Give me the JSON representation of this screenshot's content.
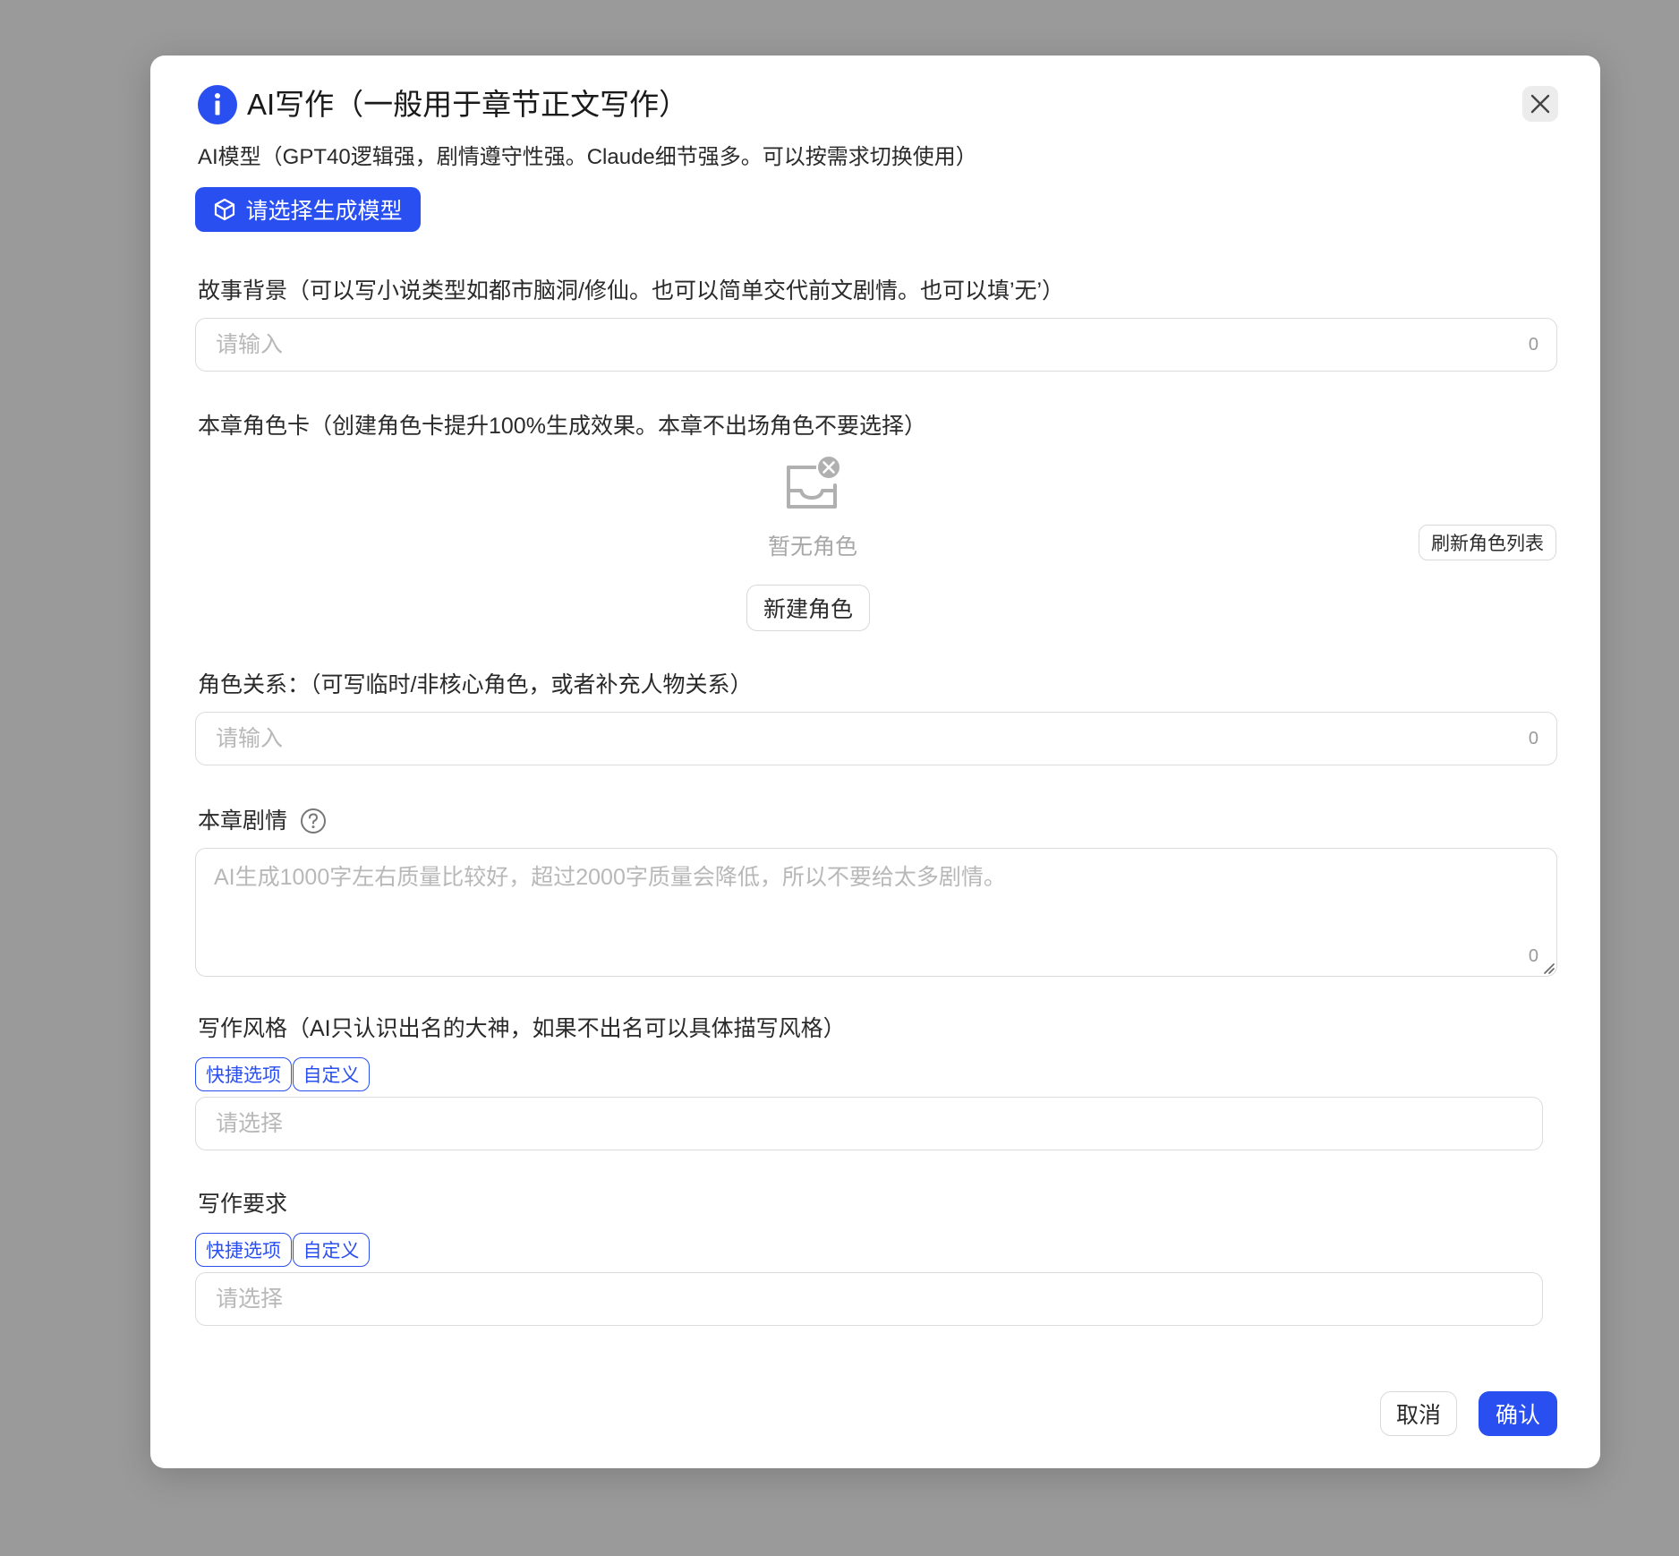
{
  "modal": {
    "title": "AI写作（一般用于章节正文写作）",
    "subtitle": "AI模型（GPT40逻辑强，剧情遵守性强。Claude细节强多。可以按需求切换使用）",
    "model_button_label": "请选择生成模型"
  },
  "story_background": {
    "label": "故事背景（可以写小说类型如都市脑洞/修仙。也可以简单交代前文剧情。也可以填’无’）",
    "placeholder": "请输入",
    "count": "0"
  },
  "role_cards": {
    "label": "本章角色卡（创建角色卡提升100%生成效果。本章不出场角色不要选择）",
    "empty_text": "暂无角色",
    "new_role_button": "新建角色",
    "refresh_button": "刷新角色列表"
  },
  "role_relations": {
    "label": "角色关系：（可写临时/非核心角色，或者补充人物关系）",
    "placeholder": "请输入",
    "count": "0"
  },
  "chapter_plot": {
    "label": "本章剧情",
    "placeholder": "AI生成1000字左右质量比较好，超过2000字质量会降低，所以不要给太多剧情。",
    "count": "0"
  },
  "writing_style": {
    "label": "写作风格（AI只认识出名的大神，如果不出名可以具体描写风格）",
    "tag_quick": "快捷选项",
    "tag_custom": "自定义",
    "placeholder": "请选择"
  },
  "writing_requirements": {
    "label": "写作要求",
    "tag_quick": "快捷选项",
    "tag_custom": "自定义",
    "placeholder": "请选择"
  },
  "footer": {
    "cancel_label": "取消",
    "confirm_label": "确认"
  },
  "colors": {
    "accent": "#2a4ff0",
    "overlay": "#9a9a9a",
    "placeholder": "#b8b8b8"
  },
  "icons": {
    "title": "info-icon",
    "close": "close-icon",
    "model": "cube-icon",
    "empty": "empty-inbox-icon",
    "help": "question-icon"
  }
}
